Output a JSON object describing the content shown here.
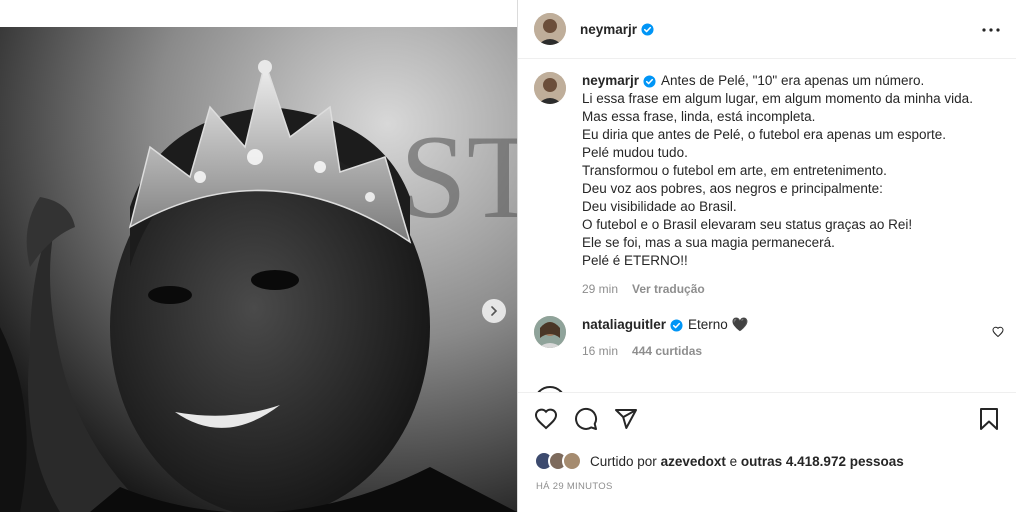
{
  "post": {
    "author": "neymarjr",
    "caption_lines": [
      "Antes de Pelé, \"10\" era apenas um número.",
      "Li essa frase em algum lugar, em algum momento da minha vida.",
      "Mas essa frase, linda, está incompleta.",
      "Eu diria que antes de Pelé, o futebol era apenas um esporte.",
      "Pelé mudou tudo.",
      "Transformou o futebol em arte, em entretenimento.",
      "Deu voz aos pobres, aos negros e principalmente:",
      "Deu visibilidade ao Brasil.",
      "O futebol e o Brasil elevaram seu status graças ao Rei!",
      "Ele se foi, mas a sua magia permanecerá.",
      "Pelé é ETERNO!!"
    ],
    "caption_time": "29 min",
    "see_translation": "Ver tradução",
    "photo_text": "ST"
  },
  "comment": {
    "author": "nataliaguitler",
    "text": "Eterno",
    "emoji": "🖤",
    "time": "16 min",
    "likes": "444 curtidas"
  },
  "likes": {
    "prefix": "Curtido por",
    "user": "azevedoxt",
    "conj": "e",
    "others": "outras 4.418.972 pessoas"
  },
  "timestamp": "HÁ 29 MINUTOS",
  "icons": {
    "verified": "verified-badge-icon",
    "more": "more-options-icon",
    "like": "heart-icon",
    "comment": "comment-bubble-icon",
    "share": "paper-plane-icon",
    "save": "bookmark-icon",
    "next": "chevron-right-icon"
  },
  "colors": {
    "verified": "#0095f6",
    "text": "#262626",
    "secondary": "#8e8e8e"
  }
}
